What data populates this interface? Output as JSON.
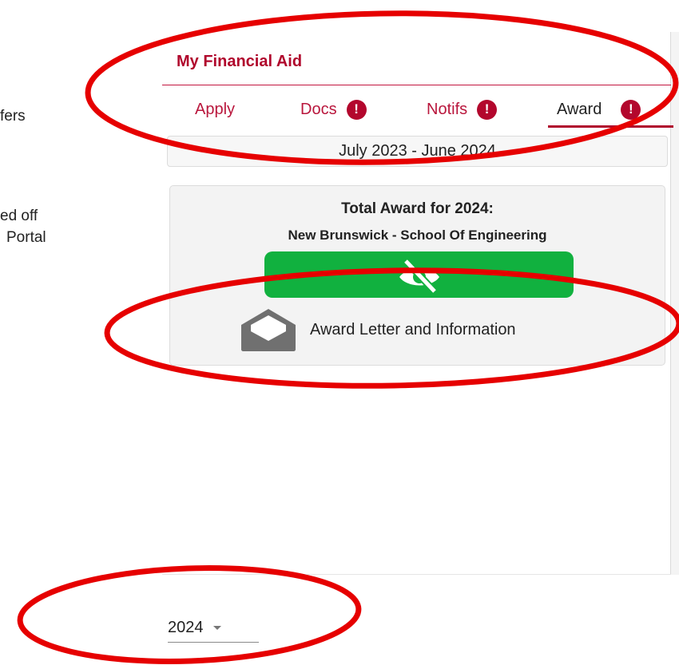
{
  "background_fragments": [
    "fers",
    "ed off",
    "Portal"
  ],
  "app": {
    "title": "My Financial Aid",
    "accent_color": "#b0062c",
    "tabs": [
      {
        "label": "Apply",
        "badge": ""
      },
      {
        "label": "Docs",
        "badge": "!"
      },
      {
        "label": "Notifs",
        "badge": "!"
      },
      {
        "label": "Award",
        "badge": "!",
        "active": true
      }
    ]
  },
  "award_period": "July 2023 - June 2024",
  "award_card": {
    "title": "Total Award for 2024:",
    "school": "New Brunswick - School Of Engineering",
    "reveal_icon": "eye-slash-icon",
    "reveal_color": "#11b13f",
    "letter_icon": "envelope-open-icon",
    "letter_label": "Award Letter and Information"
  },
  "year_select": {
    "value": "2024",
    "icon": "caret-down-icon"
  },
  "annotation_color": "#e60000"
}
